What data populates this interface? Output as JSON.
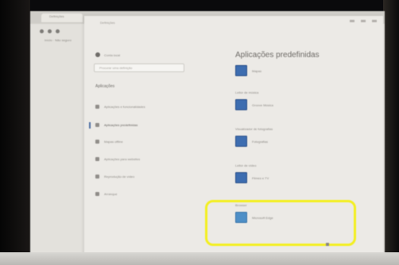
{
  "browser": {
    "tab_text": "Definições",
    "address_text": "Início · Não seguro"
  },
  "settings": {
    "window_title": "Definições",
    "profile_name": "Conta local",
    "search_placeholder": "Procurar uma definição",
    "section_heading": "Aplicações",
    "nav_items": [
      "Aplicações e funcionalidades",
      "Aplicações predefinidas",
      "Mapas offline",
      "Aplicações para websites",
      "Reprodução de vídeo",
      "Arranque"
    ]
  },
  "main": {
    "title": "Aplicações predefinidas",
    "categories": [
      {
        "label": "",
        "app": "Mapas"
      },
      {
        "label": "Leitor de música",
        "app": "Groove Música"
      },
      {
        "label": "Visualizador de fotografias",
        "app": "Fotografias"
      },
      {
        "label": "Leitor de vídeo",
        "app": "Filmes e TV"
      },
      {
        "label": "Browser",
        "app": "Microsoft Edge"
      }
    ]
  },
  "colors": {
    "highlight": "#f3ef1f",
    "app_icon": "#3d6db0"
  }
}
